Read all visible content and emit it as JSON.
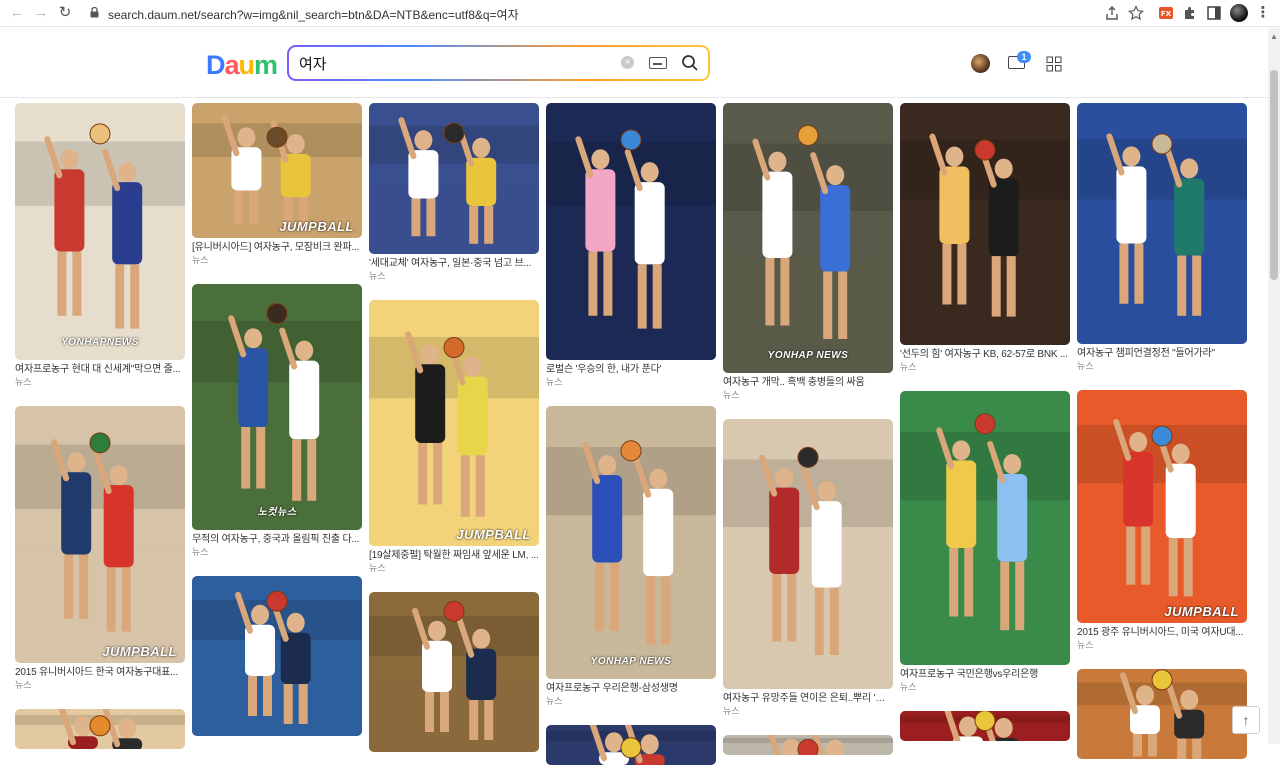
{
  "browser": {
    "url": "search.daum.net/search?w=img&nil_search=btn&DA=NTB&enc=utf8&q=여자"
  },
  "header": {
    "logo": [
      "D",
      "a",
      "u",
      "m"
    ],
    "logo_colors": [
      "#3c7bff",
      "#ff5a5a",
      "#ffb400",
      "#2ec16f"
    ],
    "search_value": "여자",
    "mail_count": "1"
  },
  "columns": [
    {
      "items": [
        {
          "caption": "여자프로농구 현대 대 신세계\"막으면 줄...",
          "source": "뉴스",
          "watermark": "YONHAPNEWS",
          "palette": [
            "#e6ddcc",
            "#c9392f",
            "#2a3d8f",
            "#e8c27a"
          ]
        },
        {
          "caption": "2015 유니버시아드 한국 여자농구대표...",
          "source": "뉴스",
          "watermark": "JUMPBALL",
          "palette": [
            "#d6c3a8",
            "#1f3a6b",
            "#d9342b",
            "#2f7d3a"
          ]
        },
        {
          "caption": "",
          "source": "",
          "watermark": "",
          "palette": [
            "#e3c9a0",
            "#9c1f1f",
            "#2b2b2b",
            "#e38a2a"
          ]
        }
      ]
    },
    {
      "items": [
        {
          "caption": "[유니버시아드] 여자농구, 모잠비크 완파...",
          "source": "뉴스",
          "watermark": "JUMPBALL",
          "palette": [
            "#c9a36b",
            "#ffffff",
            "#e8c53a",
            "#6b4a2a"
          ]
        },
        {
          "caption": "무적의 여자농구, 중국과 올림픽 진출 다...",
          "source": "뉴스",
          "watermark": "노컷뉴스",
          "palette": [
            "#4b6f3a",
            "#2a55a6",
            "#ffffff",
            "#3b2a1f"
          ]
        },
        {
          "caption": "",
          "source": "",
          "watermark": "",
          "palette": [
            "#2d5f9e",
            "#ffffff",
            "#1b2c4f",
            "#c9392f"
          ]
        }
      ]
    },
    {
      "items": [
        {
          "caption": "'세대교체' 여자농구, 일본·중국 넘고 브...",
          "source": "뉴스",
          "watermark": "",
          "palette": [
            "#3a4f8f",
            "#ffffff",
            "#e8c53a",
            "#2a2a2a"
          ]
        },
        {
          "caption": "[19살제중펄] 탁월한 짜임새 앞세운 LM, ...",
          "source": "뉴스",
          "watermark": "JUMPBALL",
          "palette": [
            "#f2d37a",
            "#1c1c1c",
            "#e8d64a",
            "#d26a2a"
          ]
        },
        {
          "caption": "",
          "source": "",
          "watermark": "",
          "palette": [
            "#8b6a3c",
            "#ffffff",
            "#1b2c4f",
            "#c9392f"
          ]
        }
      ]
    },
    {
      "items": [
        {
          "caption": "로벌슨 '우승의 한, 내가 푼다'",
          "source": "뉴스",
          "watermark": "",
          "palette": [
            "#1d2a55",
            "#f4a6c6",
            "#ffffff",
            "#3a88d8"
          ]
        },
        {
          "caption": "여자프로농구 우리은행-삼성생명",
          "source": "뉴스",
          "watermark": "YONHAP NEWS",
          "palette": [
            "#c9b79a",
            "#2b4fb8",
            "#ffffff",
            "#e6883a"
          ]
        },
        {
          "caption": "",
          "source": "",
          "watermark": "",
          "palette": [
            "#2b3a6b",
            "#ffffff",
            "#c9392f",
            "#e8c53a"
          ]
        }
      ]
    },
    {
      "items": [
        {
          "caption": "여자농구 개막.. 흑백 충병들의 싸움",
          "source": "뉴스",
          "watermark": "YONHAP NEWS",
          "palette": [
            "#5a5a4a",
            "#ffffff",
            "#3a6fd8",
            "#e8a13a"
          ]
        },
        {
          "caption": "여자농구 유망주들 연이은 은퇴..뿌리 '흔들'",
          "source": "뉴스",
          "watermark": "",
          "palette": [
            "#d9c8b0",
            "#b22a2a",
            "#ffffff",
            "#2a2a2a"
          ]
        },
        {
          "caption": "",
          "source": "",
          "watermark": "",
          "palette": [
            "#bdb7aa",
            "#ffffff",
            "#2a2a2a",
            "#c9392f"
          ]
        }
      ]
    },
    {
      "items": [
        {
          "caption": "'선두의 힘' 여자농구 KB, 62-57로 BNK ...",
          "source": "뉴스",
          "watermark": "",
          "palette": [
            "#3a2a1f",
            "#f0c060",
            "#1c1c1c",
            "#c9392f"
          ]
        },
        {
          "caption": "여자프로농구 국민은행vs우리은행",
          "source": "뉴스",
          "watermark": "",
          "palette": [
            "#3a8a4a",
            "#f0c84a",
            "#8cc0f0",
            "#c9392f"
          ]
        },
        {
          "caption": "",
          "source": "",
          "watermark": "",
          "palette": [
            "#9c1f1f",
            "#ffffff",
            "#2a2a2a",
            "#e8c53a"
          ]
        }
      ]
    },
    {
      "items": [
        {
          "caption": "여자농구 챔피언결정전 \"들어가라\"",
          "source": "뉴스",
          "watermark": "",
          "palette": [
            "#2a4f9e",
            "#ffffff",
            "#1f7a6a",
            "#c9b79a"
          ]
        },
        {
          "caption": "2015 광주 유니버시아드, 미국 여자U대...",
          "source": "뉴스",
          "watermark": "JUMPBALL",
          "palette": [
            "#e85a2a",
            "#d9342b",
            "#ffffff",
            "#3a8ad8"
          ]
        },
        {
          "caption": "",
          "source": "",
          "watermark": "",
          "palette": [
            "#c97a3a",
            "#ffffff",
            "#2a2a2a",
            "#e8c53a"
          ]
        }
      ]
    }
  ]
}
